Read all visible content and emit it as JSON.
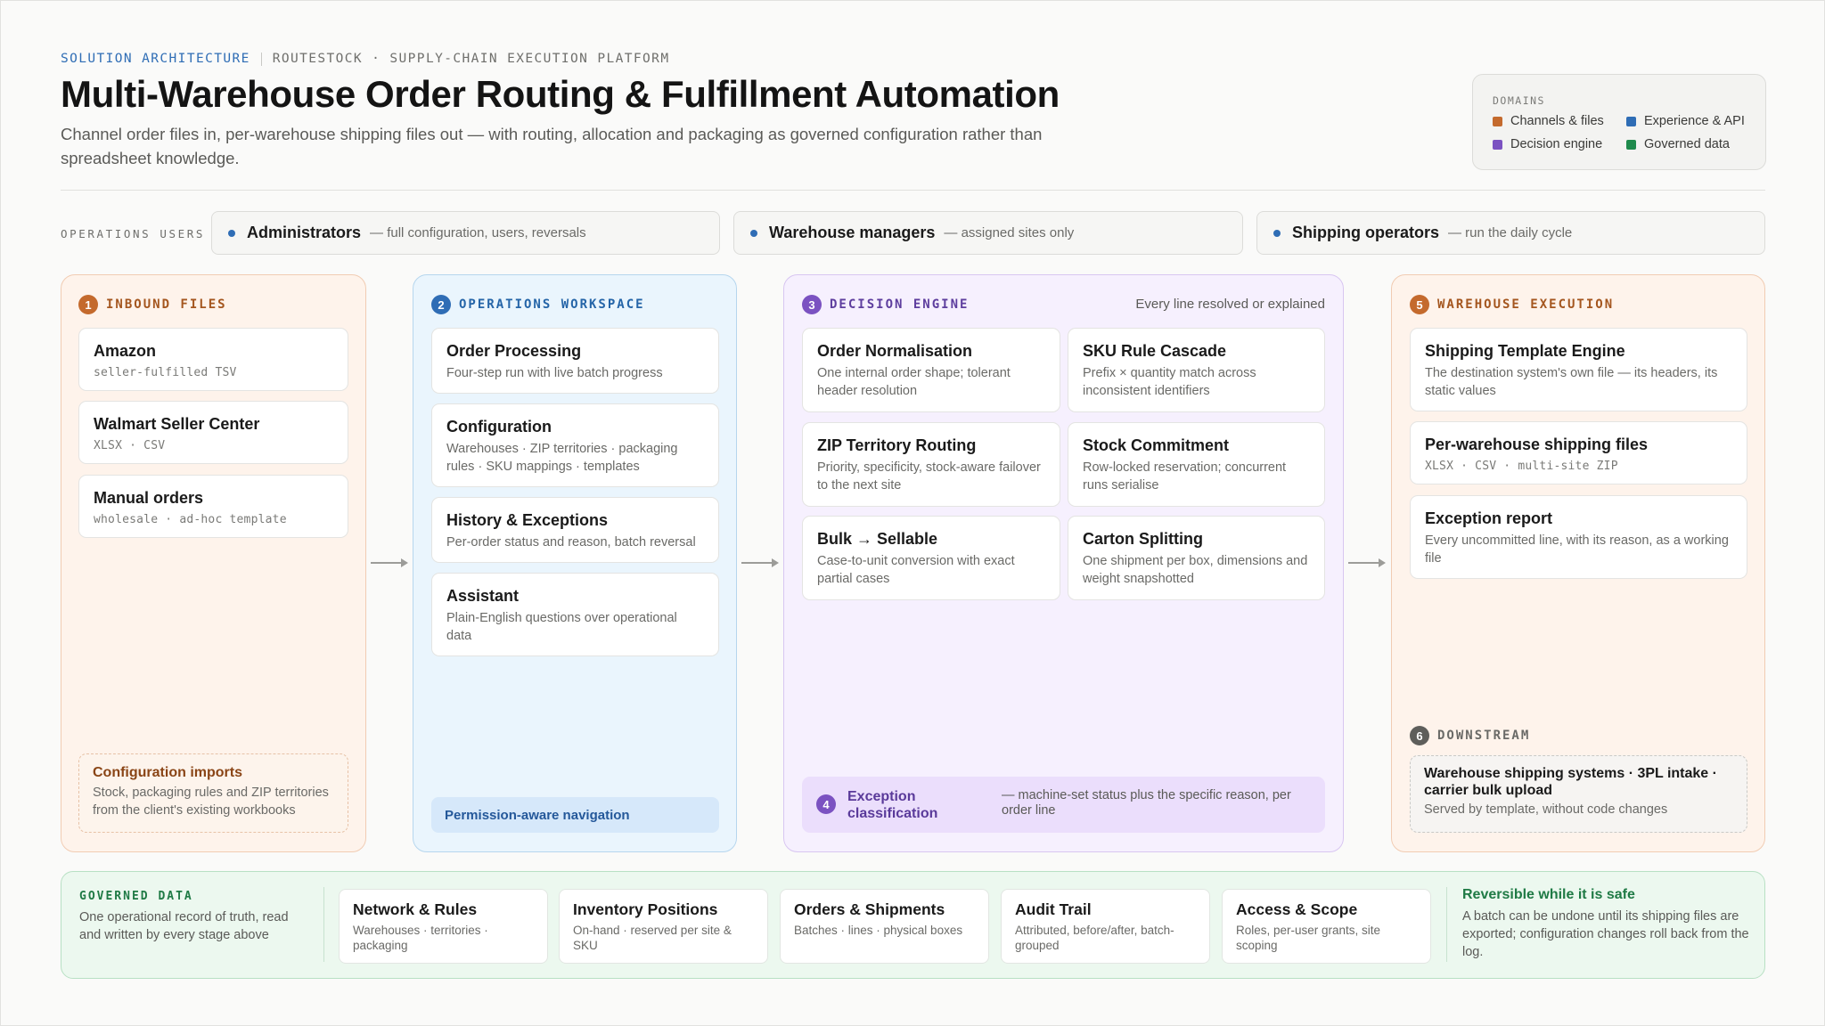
{
  "header": {
    "eyebrow_primary": "SOLUTION ARCHITECTURE",
    "eyebrow_secondary": "ROUTESTOCK · SUPPLY-CHAIN EXECUTION PLATFORM",
    "title": "Multi-Warehouse Order Routing & Fulfillment Automation",
    "subtitle": "Channel order files in, per-warehouse shipping files out — with routing, allocation and packaging as governed configuration rather than spreadsheet knowledge."
  },
  "legend": {
    "title": "DOMAINS",
    "items": [
      {
        "label": "Channels & files",
        "color": "#c46a2d"
      },
      {
        "label": "Experience & API",
        "color": "#2f6db5"
      },
      {
        "label": "Decision engine",
        "color": "#7b52c1"
      },
      {
        "label": "Governed data",
        "color": "#1f8a4c"
      }
    ]
  },
  "users": {
    "label": "OPERATIONS USERS",
    "items": [
      {
        "name": "Administrators",
        "desc": "— full configuration, users, reversals"
      },
      {
        "name": "Warehouse managers",
        "desc": "— assigned sites only"
      },
      {
        "name": "Shipping operators",
        "desc": "— run the daily cycle"
      }
    ]
  },
  "inbound": {
    "num": "1",
    "title": "INBOUND FILES",
    "cards": [
      {
        "title": "Amazon",
        "meta": "seller-fulfilled TSV"
      },
      {
        "title": "Walmart Seller Center",
        "meta": "XLSX · CSV"
      },
      {
        "title": "Manual orders",
        "meta": "wholesale · ad-hoc template"
      }
    ],
    "footer": {
      "title": "Configuration imports",
      "desc": "Stock, packaging rules and ZIP territories from the client's existing workbooks"
    }
  },
  "workspace": {
    "num": "2",
    "title": "OPERATIONS WORKSPACE",
    "cards": [
      {
        "title": "Order Processing",
        "desc": "Four-step run with live batch progress"
      },
      {
        "title": "Configuration",
        "desc": "Warehouses · ZIP territories · packaging rules · SKU mappings · templates"
      },
      {
        "title": "History & Exceptions",
        "desc": "Per-order status and reason, batch reversal"
      },
      {
        "title": "Assistant",
        "desc": "Plain-English questions over operational data"
      }
    ],
    "footer": "Permission-aware navigation"
  },
  "engine": {
    "num": "3",
    "title": "DECISION ENGINE",
    "note": "Every line resolved or explained",
    "cards": [
      {
        "title": "Order Normalisation",
        "desc": "One internal order shape; tolerant header resolution"
      },
      {
        "title": "SKU Rule Cascade",
        "desc": "Prefix × quantity match across inconsistent identifiers"
      },
      {
        "title": "ZIP Territory Routing",
        "desc": "Priority, specificity, stock-aware failover to the next site"
      },
      {
        "title": "Stock Commitment",
        "desc": "Row-locked reservation; concurrent runs serialise"
      },
      {
        "title": "Bulk → Sellable",
        "desc": "Case-to-unit conversion with exact partial cases"
      },
      {
        "title": "Carton Splitting",
        "desc": "One shipment per box, dimensions and weight snapshotted"
      }
    ],
    "exception": {
      "num": "4",
      "title": "Exception classification",
      "desc": "— machine-set status plus the specific reason, per order line"
    }
  },
  "execution": {
    "num": "5",
    "title": "WAREHOUSE EXECUTION",
    "cards": [
      {
        "title": "Shipping Template Engine",
        "desc": "The destination system's own file — its headers, its static values"
      },
      {
        "title": "Per-warehouse shipping files",
        "meta": "XLSX · CSV · multi-site ZIP"
      },
      {
        "title": "Exception report",
        "desc": "Every uncommitted line, with its reason, as a working file"
      }
    ],
    "downstream": {
      "num": "6",
      "title": "DOWNSTREAM",
      "card_title": "Warehouse shipping systems · 3PL intake · carrier bulk upload",
      "card_desc": "Served by template, without code changes"
    }
  },
  "governed": {
    "title": "GOVERNED DATA",
    "desc": "One operational record of truth, read and written by every stage above",
    "cards": [
      {
        "title": "Network & Rules",
        "desc": "Warehouses · territories · packaging"
      },
      {
        "title": "Inventory Positions",
        "desc": "On-hand · reserved per site & SKU"
      },
      {
        "title": "Orders & Shipments",
        "desc": "Batches · lines · physical boxes"
      },
      {
        "title": "Audit Trail",
        "desc": "Attributed, before/after, batch-grouped"
      },
      {
        "title": "Access & Scope",
        "desc": "Roles, per-user grants, site scoping"
      }
    ],
    "reversible": {
      "title": "Reversible while it is safe",
      "desc": "A batch can be undone until its shipping files are exported; configuration changes roll back from the log."
    }
  }
}
